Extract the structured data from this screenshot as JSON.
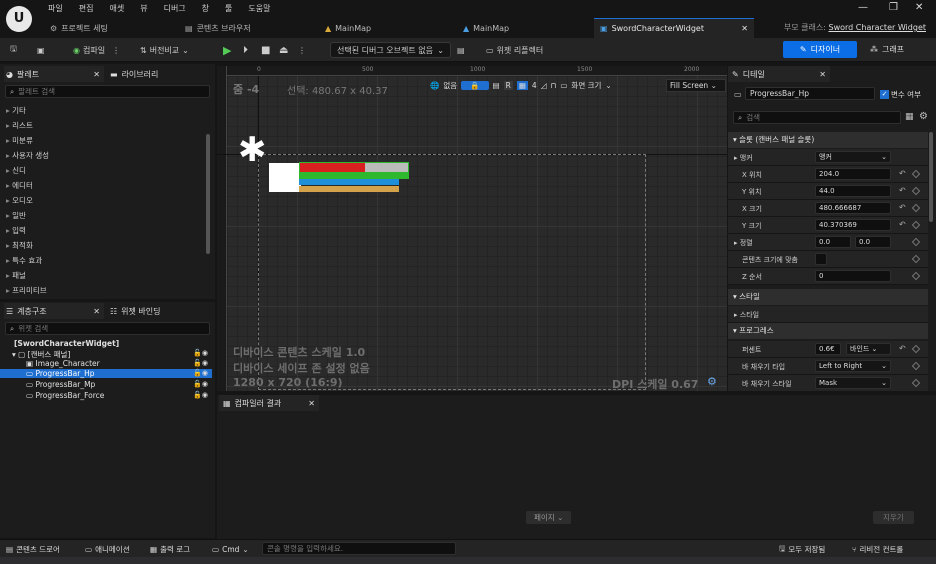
{
  "menu": [
    "파일",
    "편집",
    "애셋",
    "뷰",
    "디버그",
    "창",
    "툴",
    "도움말"
  ],
  "tabs": [
    {
      "label": "프로젝트 세팅"
    },
    {
      "label": "콘텐츠 브라우저"
    },
    {
      "label": "MainMap"
    },
    {
      "label": "MainMap"
    },
    {
      "label": "SwordCharacterWidget"
    }
  ],
  "parent_class": {
    "label": "부모 클래스:",
    "value": "Sword Character Widget"
  },
  "toolbar": {
    "compile": "컴파일",
    "diff": "버전비교",
    "debug_object": "선택된 디버그 오브젝트 없음",
    "widget_reflector": "위젯 리플렉터",
    "designer": "디자이너",
    "graph": "그래프"
  },
  "palette": {
    "tab": "팔레트",
    "library_tab": "라이브러리",
    "search_placeholder": "팔레트 검색",
    "items": [
      "기타",
      "리스트",
      "미분류",
      "사용자 생성",
      "신디",
      "에디터",
      "오디오",
      "일반",
      "입력",
      "최적화",
      "특수 효과",
      "패널",
      "프리미티브"
    ]
  },
  "hierarchy": {
    "tab": "계층구조",
    "binding_tab": "위젯 바인딩",
    "search_placeholder": "위젯 검색",
    "root": "[SwordCharacterWidget]",
    "canvas": "[캔버스 패널]",
    "children": [
      "Image_Character",
      "ProgressBar_Hp",
      "ProgressBar_Mp",
      "ProgressBar_Force"
    ]
  },
  "viewport": {
    "zoom": "줌 -4",
    "selection": "선택: 480.67 x 40.37",
    "none_label": "없음",
    "r_label": "R",
    "grid_num": "4",
    "screen_size": "화면 크기",
    "fill_mode": "Fill Screen",
    "ruler": [
      "0",
      "500",
      "1000",
      "1500",
      "2000"
    ],
    "dpi_scale": "디바이스 콘텐츠 스케일 1.0",
    "safe_zone": "디바이스 세이프 존 설정 없음",
    "resolution": "1280 x 720 (16:9)",
    "dpi": "DPI 스케일 0.67",
    "widget_colors": {
      "hp": "#d92020",
      "mp": "#1e8fd8",
      "force": "#d4a24a",
      "frame": "#2eb82e"
    },
    "hp_fraction": 0.6
  },
  "details": {
    "tab": "디테일",
    "name": "ProgressBar_Hp",
    "is_variable": "변수 여부",
    "search_placeholder": "검색",
    "slot_section": "슬롯 (캔버스 패널 슬롯)",
    "anchor_label": "앵커",
    "anchor_value": "앵커",
    "x_pos_label": "X 위치",
    "x_pos": "204.0",
    "y_pos_label": "Y 위치",
    "y_pos": "44.0",
    "x_size_label": "X 크기",
    "x_size": "480.666687",
    "y_size_label": "Y 크기",
    "y_size": "40.370369",
    "align_label": "정렬",
    "align_x": "0.0",
    "align_y": "0.0",
    "size_to_content": "콘텐츠 크기에 맞춤",
    "z_order_label": "Z 순서",
    "z_order": "0",
    "style_section": "스타일",
    "style_row": "스타일",
    "progress_section": "프로그레스",
    "percent_label": "퍼센트",
    "percent": "0.6€",
    "bind": "바인드",
    "fill_type_label": "바 채우기 타입",
    "fill_type": "Left to Right",
    "fill_style_label": "바 채우기 스타일",
    "fill_style": "Mask"
  },
  "compiler": {
    "tab": "컴파일러 결과",
    "page": "페이지",
    "clear": "지우기"
  },
  "status": {
    "content_drawer": "콘텐츠 드로어",
    "animation": "애니메이션",
    "output_log": "출력 로그",
    "cmd": "Cmd",
    "cmd_placeholder": "콘솔 명령을 입력하세요.",
    "save_all": "모두 저장됨",
    "revision": "리비전 컨트롤"
  }
}
